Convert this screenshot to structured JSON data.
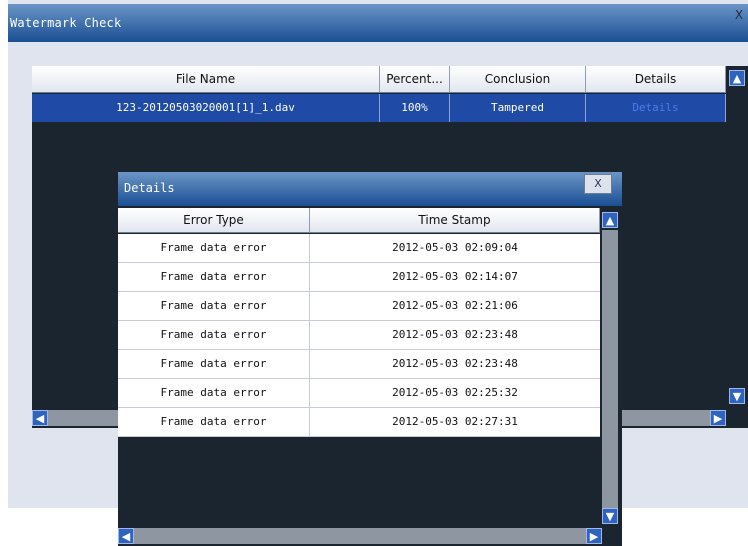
{
  "main_window": {
    "title": "Watermark Check",
    "close_glyph": "X",
    "columns": [
      "File Name",
      "Percent...",
      "Conclusion",
      "Details"
    ],
    "selected_row": {
      "file_name": "123-20120503020001[1]_1.dav",
      "percent": "100%",
      "conclusion": "Tampered",
      "details": "Details"
    }
  },
  "details_dialog": {
    "title": "Details",
    "close_glyph": "X",
    "columns": [
      "Error Type",
      "Time Stamp"
    ],
    "rows": [
      {
        "error": "Frame data error",
        "time": "2012-05-03 02:09:04"
      },
      {
        "error": "Frame data error",
        "time": "2012-05-03 02:14:07"
      },
      {
        "error": "Frame data error",
        "time": "2012-05-03 02:21:06"
      },
      {
        "error": "Frame data error",
        "time": "2012-05-03 02:23:48"
      },
      {
        "error": "Frame data error",
        "time": "2012-05-03 02:23:48"
      },
      {
        "error": "Frame data error",
        "time": "2012-05-03 02:25:32"
      },
      {
        "error": "Frame data error",
        "time": "2012-05-03 02:27:31"
      }
    ]
  },
  "icons": {
    "scroll_up": "chevron-up-icon",
    "scroll_down": "chevron-down-icon",
    "scroll_left": "chevron-left-icon",
    "scroll_right": "chevron-right-icon",
    "close": "close-icon"
  },
  "colors": {
    "titlebar": "#1a4f94",
    "selection": "#1f4aa6",
    "details_link": "#1f4fd8",
    "list_background": "#1b2530"
  }
}
